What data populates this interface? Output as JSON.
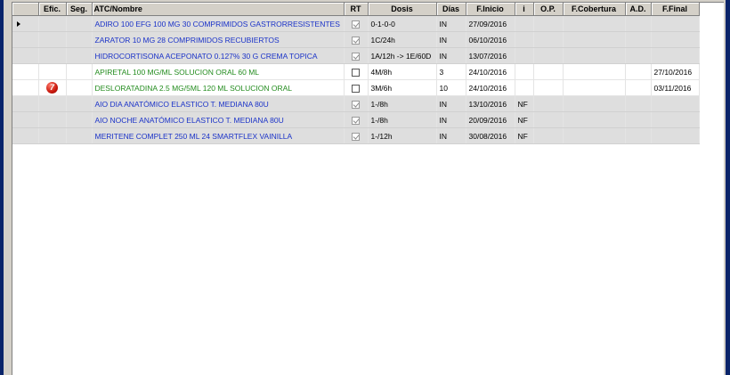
{
  "columns": {
    "efic": "Efic.",
    "seg": "Seg.",
    "atc_nombre": "ATC/Nombre",
    "rt": "RT",
    "dosis": "Dosis",
    "dias": "Días",
    "f_inicio": "F.Inicio",
    "i": "i",
    "op": "O.P.",
    "f_cobertura": "F.Cobertura",
    "ad": "A.D.",
    "f_final": "F.Final"
  },
  "rows": [
    {
      "name": "ADIRO 100 EFG 100 MG 30 COMPRIMIDOS GASTRORRESISTENTES",
      "color": "#1b33c8",
      "rt": true,
      "rt_enabled": false,
      "dosis": "0-1-0-0",
      "dias": "IN",
      "f_inicio": "27/09/2016",
      "i": "",
      "op": "",
      "f_cobertura": "",
      "ad": "",
      "f_final": "",
      "current": true,
      "alert": ""
    },
    {
      "name": "ZARATOR 10 MG 28 COMPRIMIDOS RECUBIERTOS",
      "color": "#1b33c8",
      "rt": true,
      "rt_enabled": false,
      "dosis": "1C/24h",
      "dias": "IN",
      "f_inicio": "06/10/2016",
      "i": "",
      "op": "",
      "f_cobertura": "",
      "ad": "",
      "f_final": "",
      "current": false,
      "alert": ""
    },
    {
      "name": "HIDROCORTISONA ACEPONATO 0.127% 30 G CREMA TOPICA",
      "color": "#1b33c8",
      "rt": true,
      "rt_enabled": false,
      "dosis": "1A/12h -> 1E/60D",
      "dias": "IN",
      "f_inicio": "13/07/2016",
      "i": "",
      "op": "",
      "f_cobertura": "",
      "ad": "",
      "f_final": "",
      "current": false,
      "alert": ""
    },
    {
      "name": "APIRETAL 100 MG/ML SOLUCION ORAL 60 ML",
      "color": "#238c1e",
      "rt": false,
      "rt_enabled": true,
      "dosis": "4M/8h",
      "dias": "3",
      "f_inicio": "24/10/2016",
      "i": "",
      "op": "",
      "f_cobertura": "",
      "ad": "",
      "f_final": "27/10/2016",
      "current": false,
      "alert": ""
    },
    {
      "name": "DESLORATADINA 2.5 MG/5ML 120 ML SOLUCION ORAL",
      "color": "#238c1e",
      "rt": false,
      "rt_enabled": true,
      "dosis": "3M/6h",
      "dias": "10",
      "f_inicio": "24/10/2016",
      "i": "",
      "op": "",
      "f_cobertura": "",
      "ad": "",
      "f_final": "03/11/2016",
      "current": false,
      "alert": "7"
    },
    {
      "name": "AIO DIA ANATÓMICO ELASTICO T. MEDIANA 80U",
      "color": "#1b33c8",
      "rt": true,
      "rt_enabled": false,
      "dosis": "1-/8h",
      "dias": "IN",
      "f_inicio": "13/10/2016",
      "i": "NF",
      "op": "",
      "f_cobertura": "",
      "ad": "",
      "f_final": "",
      "current": false,
      "alert": ""
    },
    {
      "name": "AIO NOCHE ANATÓMICO ELASTICO T. MEDIANA 80U",
      "color": "#1b33c8",
      "rt": true,
      "rt_enabled": false,
      "dosis": "1-/8h",
      "dias": "IN",
      "f_inicio": "20/09/2016",
      "i": "NF",
      "op": "",
      "f_cobertura": "",
      "ad": "",
      "f_final": "",
      "current": false,
      "alert": ""
    },
    {
      "name": "MERITENE COMPLET 250 ML 24 SMARTFLEX VAINILLA",
      "color": "#1b33c8",
      "rt": true,
      "rt_enabled": false,
      "dosis": "1-/12h",
      "dias": "IN",
      "f_inicio": "30/08/2016",
      "i": "NF",
      "op": "",
      "f_cobertura": "",
      "ad": "",
      "f_final": "",
      "current": false,
      "alert": ""
    }
  ],
  "icons": {
    "current_row": "row-pointer-arrow-icon",
    "alert": "interaction-alert-icon",
    "checkbox": "checkbox-icon"
  }
}
